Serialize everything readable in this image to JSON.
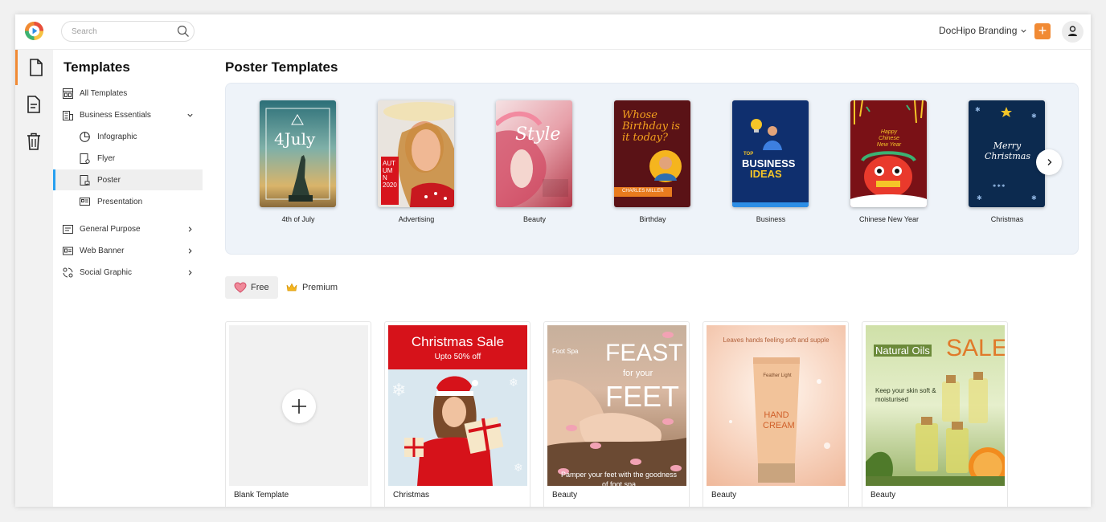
{
  "topbar": {
    "search_placeholder": "Search",
    "brand_label": "DocHipo Branding",
    "add_label": "+"
  },
  "sidebar": {
    "title": "Templates",
    "items": [
      {
        "label": "All Templates"
      },
      {
        "label": "Business Essentials"
      },
      {
        "label": "Infographic"
      },
      {
        "label": "Flyer"
      },
      {
        "label": "Poster"
      },
      {
        "label": "Presentation"
      },
      {
        "label": "General Purpose"
      },
      {
        "label": "Web Banner"
      },
      {
        "label": "Social Graphic"
      }
    ]
  },
  "main": {
    "title": "Poster Templates",
    "categories": [
      {
        "label": "4th of July",
        "thumb_text": "4July"
      },
      {
        "label": "Advertising",
        "thumb_text": "AUTUMN 2020"
      },
      {
        "label": "Beauty",
        "thumb_text": "Style"
      },
      {
        "label": "Birthday",
        "thumb_text": "Whose Birthday is it today?",
        "thumb_subtext": "CHARLES MILLER"
      },
      {
        "label": "Business",
        "thumb_text": "BUSINESS",
        "thumb_subtext": "IDEAS",
        "thumb_kicker": "TOP"
      },
      {
        "label": "Chinese New Year",
        "thumb_text": "Happy Chinese New Year"
      },
      {
        "label": "Christmas",
        "thumb_text": "Merry Christmas"
      }
    ],
    "filters": {
      "free": "Free",
      "premium": "Premium"
    },
    "templates": [
      {
        "label": "Blank Template"
      },
      {
        "label": "Christmas",
        "headline": "Christmas Sale",
        "subline": "Upto 50% off"
      },
      {
        "label": "Beauty",
        "headline": "FEAST",
        "mid": "for your",
        "headline2": "FEET",
        "kicker": "Foot Spa",
        "footer": "Pamper your feet with the goodness of foot spa"
      },
      {
        "label": "Beauty",
        "headline": "Leaves hands feeling soft and supple",
        "tube_top": "Feather Light",
        "tube_text": "HAND CREAM"
      },
      {
        "label": "Beauty",
        "headline": "Natural Oils",
        "headline2": "SALE",
        "subline": "Keep your skin soft & moisturised"
      }
    ]
  },
  "colors": {
    "accent": "#f18a34",
    "active_nav": "#27a0f0",
    "carousel_bg": "#eef3f9",
    "christmas_red": "#d6121a"
  }
}
